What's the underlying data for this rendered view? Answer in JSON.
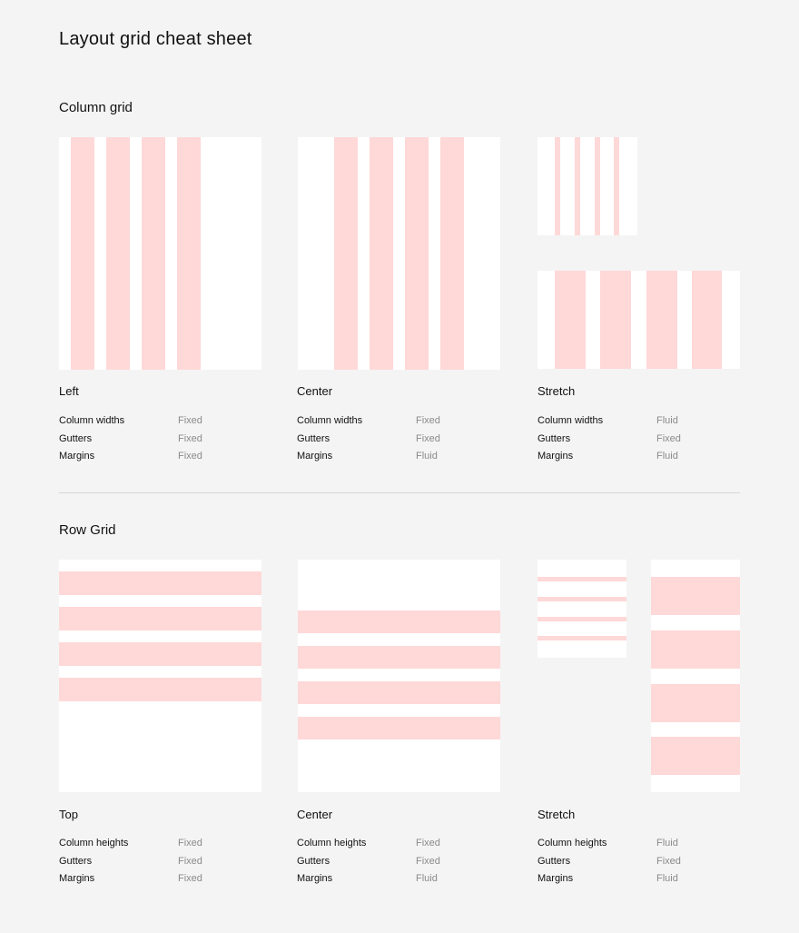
{
  "page": {
    "title": "Layout grid cheat sheet",
    "colors": {
      "background": "#f4f4f4",
      "frame": "#ffffff",
      "grid": "#ffd8d8",
      "divider": "#d6d6d6"
    }
  },
  "column_grid": {
    "title": "Column grid",
    "variants": [
      {
        "name": "Left",
        "specs": [
          {
            "label": "Column widths",
            "value": "Fixed"
          },
          {
            "label": "Gutters",
            "value": "Fixed"
          },
          {
            "label": "Margins",
            "value": "Fixed"
          }
        ]
      },
      {
        "name": "Center",
        "specs": [
          {
            "label": "Column widths",
            "value": "Fixed"
          },
          {
            "label": "Gutters",
            "value": "Fixed"
          },
          {
            "label": "Margins",
            "value": "Fluid"
          }
        ]
      },
      {
        "name": "Stretch",
        "specs": [
          {
            "label": "Column widths",
            "value": "Fluid"
          },
          {
            "label": "Gutters",
            "value": "Fixed"
          },
          {
            "label": "Margins",
            "value": "Fluid"
          }
        ]
      }
    ]
  },
  "row_grid": {
    "title": "Row Grid",
    "variants": [
      {
        "name": "Top",
        "specs": [
          {
            "label": "Column heights",
            "value": "Fixed"
          },
          {
            "label": "Gutters",
            "value": "Fixed"
          },
          {
            "label": "Margins",
            "value": "Fixed"
          }
        ]
      },
      {
        "name": "Center",
        "specs": [
          {
            "label": "Column heights",
            "value": "Fixed"
          },
          {
            "label": "Gutters",
            "value": "Fixed"
          },
          {
            "label": "Margins",
            "value": "Fluid"
          }
        ]
      },
      {
        "name": "Stretch",
        "specs": [
          {
            "label": "Column heights",
            "value": "Fluid"
          },
          {
            "label": "Gutters",
            "value": "Fixed"
          },
          {
            "label": "Margins",
            "value": "Fluid"
          }
        ]
      }
    ]
  }
}
